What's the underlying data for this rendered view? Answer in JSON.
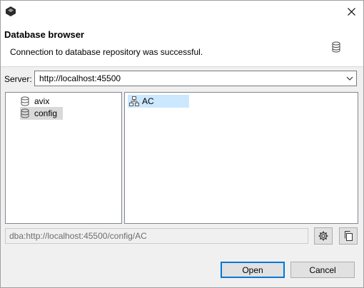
{
  "dialog": {
    "title": "Database browser",
    "message": "Connection to database repository was successful."
  },
  "server": {
    "label": "Server:",
    "value": "http://localhost:45500"
  },
  "databases": [
    {
      "label": "avix",
      "selected": false
    },
    {
      "label": "config",
      "selected": true
    }
  ],
  "repositories": [
    {
      "label": "AC",
      "selected": true
    }
  ],
  "path": {
    "value": "dba:http://localhost:45500/config/AC"
  },
  "buttons": {
    "open": "Open",
    "cancel": "Cancel"
  },
  "icons": {
    "app": "app-logo-icon",
    "close": "close-icon",
    "database": "database-icon",
    "dropdown": "chevron-down-icon",
    "repository": "repository-tree-icon",
    "settings": "gear-icon",
    "copy": "copy-icon"
  },
  "colors": {
    "selection": "#cce8ff",
    "default_button_border": "#0078d7"
  }
}
